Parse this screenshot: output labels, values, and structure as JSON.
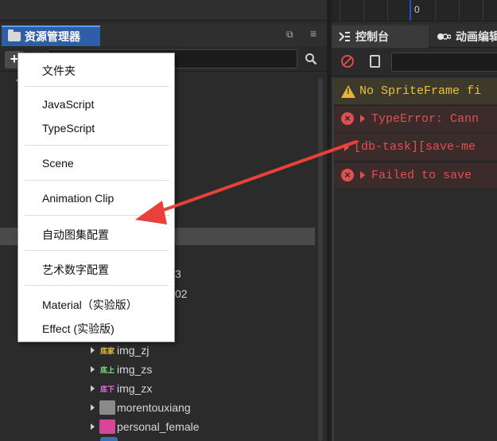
{
  "timeline": {
    "frame_label": "0"
  },
  "assets_panel": {
    "tab_label": "资源管理器",
    "add_button_label": "+",
    "maximize_glyph": "⧉",
    "menu_glyph": "≡",
    "tree_fragments": {
      "f1": "3",
      "f2": "02"
    },
    "items": [
      {
        "thumb_text": "底家",
        "name": "img_zj",
        "thumb_color": "#e8c23c"
      },
      {
        "thumb_text": "底上",
        "name": "img_zs",
        "thumb_color": "#7ee07e"
      },
      {
        "thumb_text": "底下",
        "name": "img_zx",
        "thumb_color": "#e06ee0"
      },
      {
        "thumb_text": "",
        "name": "morentouxiang",
        "thumb_color": "#9a9a9a"
      },
      {
        "thumb_text": "",
        "name": "personal_female",
        "thumb_color": "#e04fa8"
      }
    ]
  },
  "context_menu": {
    "items": [
      {
        "label": "文件夹"
      },
      {
        "label": "JavaScript"
      },
      {
        "label": "TypeScript"
      },
      {
        "label": "Scene"
      },
      {
        "label": "Animation Clip"
      },
      {
        "label": "自动图集配置"
      },
      {
        "label": "艺术数字配置"
      },
      {
        "label": "Material（实验版）"
      },
      {
        "label": "Effect (实验版)"
      }
    ]
  },
  "console_panel": {
    "tab_label": "控制台",
    "anim_tab_label": "动画编辑",
    "logs": [
      {
        "level": "warning",
        "text": "No SpriteFrame fi"
      },
      {
        "level": "error",
        "text": "TypeError: Cann"
      },
      {
        "level": "error-child",
        "text": "[db-task][save-me"
      },
      {
        "level": "error",
        "text": "Failed to save"
      }
    ]
  },
  "colors": {
    "accent": "#2f5ea8",
    "warning": "#e8c23c",
    "error": "#e0504f",
    "annotation_arrow": "#e8413c"
  }
}
